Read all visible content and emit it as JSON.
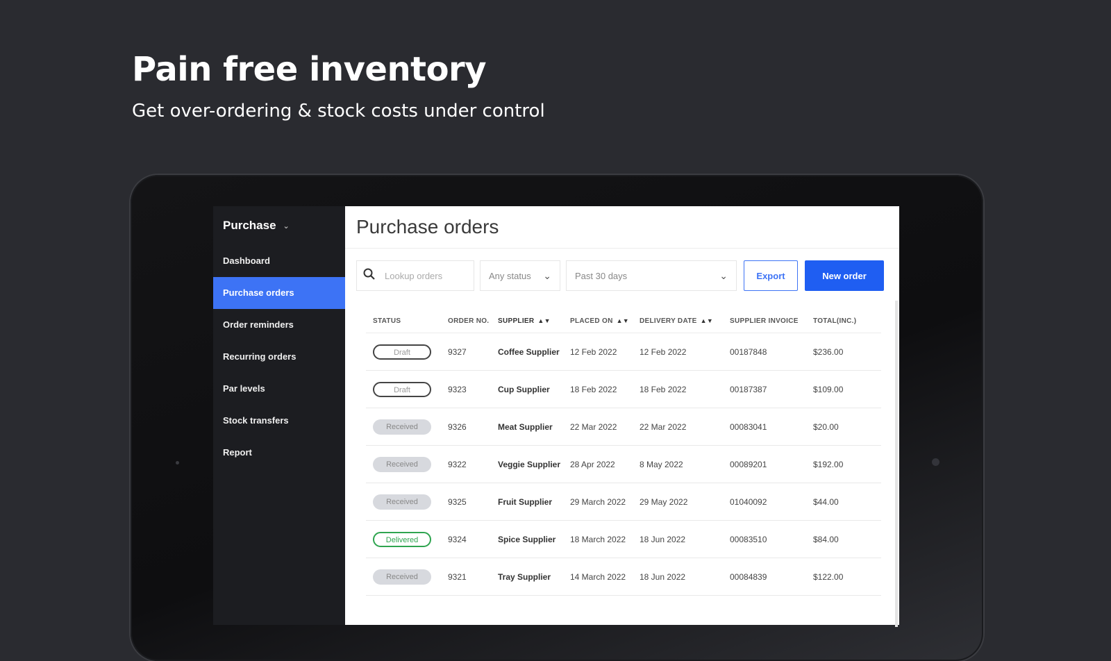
{
  "hero": {
    "title": "Pain free inventory",
    "subtitle": "Get over-ordering & stock costs under control"
  },
  "sidebar": {
    "header": "Purchase",
    "items": [
      {
        "label": "Dashboard",
        "active": false
      },
      {
        "label": "Purchase orders",
        "active": true
      },
      {
        "label": "Order reminders",
        "active": false
      },
      {
        "label": "Recurring orders",
        "active": false
      },
      {
        "label": "Par levels",
        "active": false
      },
      {
        "label": "Stock transfers",
        "active": false
      },
      {
        "label": "Report",
        "active": false
      }
    ]
  },
  "main": {
    "title": "Purchase orders",
    "search": {
      "placeholder": "Lookup orders"
    },
    "status_filter": "Any status",
    "date_filter": "Past 30 days",
    "export_label": "Export",
    "new_order_label": "New order"
  },
  "table": {
    "headers": [
      "STATUS",
      "ORDER NO.",
      "SUPPLIER",
      "PLACED ON",
      "DELIVERY DATE",
      "SUPPLIER INVOICE",
      "TOTAL(INC.)"
    ],
    "rows": [
      {
        "status": "Draft",
        "status_type": "draft",
        "order_no": "9327",
        "supplier": "Coffee Supplier",
        "placed_on": "12 Feb 2022",
        "delivery_date": "12 Feb 2022",
        "invoice": "00187848",
        "total": "$236.00"
      },
      {
        "status": "Draft",
        "status_type": "draft",
        "order_no": "9323",
        "supplier": "Cup Supplier",
        "placed_on": "18 Feb 2022",
        "delivery_date": "18 Feb 2022",
        "invoice": "00187387",
        "total": "$109.00"
      },
      {
        "status": "Received",
        "status_type": "received",
        "order_no": "9326",
        "supplier": "Meat Supplier",
        "placed_on": "22 Mar 2022",
        "delivery_date": "22 Mar 2022",
        "invoice": "00083041",
        "total": "$20.00"
      },
      {
        "status": "Received",
        "status_type": "received",
        "order_no": "9322",
        "supplier": "Veggie Supplier",
        "placed_on": "28 Apr 2022",
        "delivery_date": "8 May 2022",
        "invoice": "00089201",
        "total": "$192.00"
      },
      {
        "status": "Received",
        "status_type": "received",
        "order_no": "9325",
        "supplier": "Fruit Supplier",
        "placed_on": "29 March 2022",
        "delivery_date": "29 May 2022",
        "invoice": "01040092",
        "total": "$44.00"
      },
      {
        "status": "Delivered",
        "status_type": "delivered",
        "order_no": "9324",
        "supplier": "Spice Supplier",
        "placed_on": "18 March 2022",
        "delivery_date": "18 Jun 2022",
        "invoice": "00083510",
        "total": "$84.00"
      },
      {
        "status": "Received",
        "status_type": "received",
        "order_no": "9321",
        "supplier": "Tray Supplier",
        "placed_on": "14 March 2022",
        "delivery_date": "18 Jun 2022",
        "invoice": "00084839",
        "total": "$122.00"
      }
    ]
  },
  "colors": {
    "background": "#2a2b30",
    "sidebar": "#1c1d21",
    "accent": "#1f5ef2",
    "active_nav": "#3d73f5",
    "delivered": "#2ea44f"
  }
}
